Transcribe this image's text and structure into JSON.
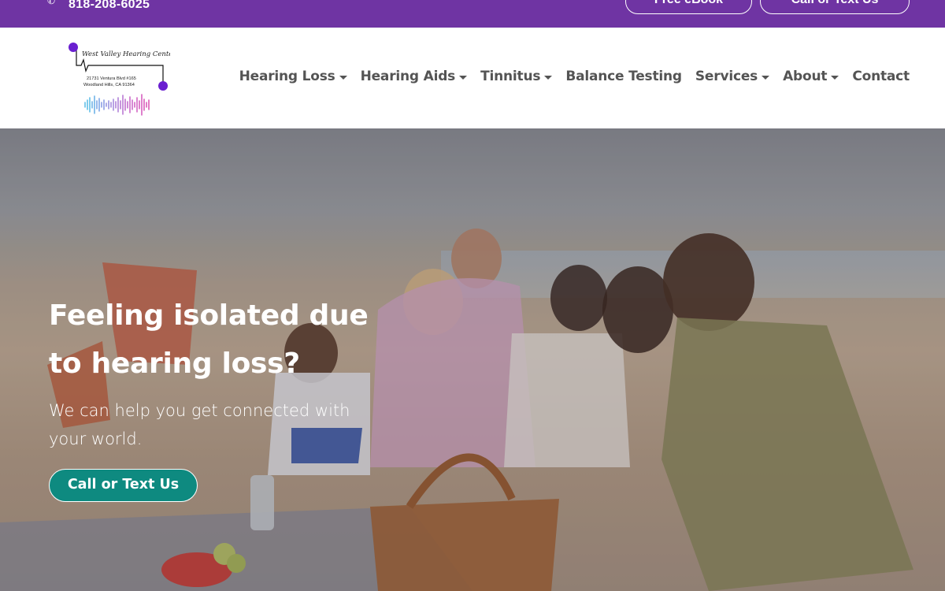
{
  "topbar": {
    "phone_icon": "phone-icon",
    "phone": "818-208-6025",
    "ebook_button": "Free eBook",
    "call_button": "Call or Text Us"
  },
  "logo": {
    "text": "West Valley Hearing Center",
    "address_line1": "21731 Ventura Blvd #165",
    "address_line2": "Woodland Hills, CA 91364"
  },
  "nav": {
    "items": [
      {
        "label": "Hearing Loss",
        "dropdown": true
      },
      {
        "label": "Hearing Aids",
        "dropdown": true
      },
      {
        "label": "Tinnitus",
        "dropdown": true
      },
      {
        "label": "Balance Testing",
        "dropdown": false
      },
      {
        "label": "Services",
        "dropdown": true
      },
      {
        "label": "About",
        "dropdown": true
      },
      {
        "label": "Contact",
        "dropdown": false
      }
    ]
  },
  "hero": {
    "title_line1": "Feeling isolated due",
    "title_line2": "to hearing loss?",
    "subtitle_line1": "We can help you get connected with",
    "subtitle_line2": "your world.",
    "cta": "Call or Text Us"
  },
  "colors": {
    "brand_purple": "#6f34a3",
    "cta_teal": "#0e8a80",
    "nav_text": "#545454"
  }
}
